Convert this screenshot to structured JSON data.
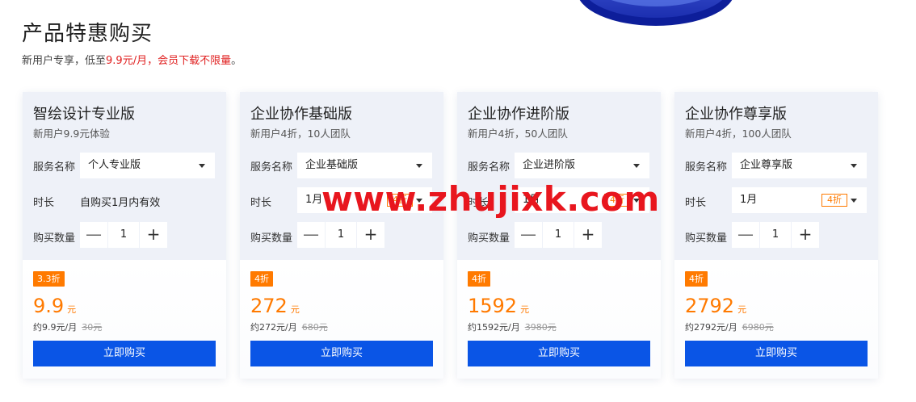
{
  "page": {
    "title": "产品特惠购买",
    "subtitle_prefix": "新用户专享，低至",
    "subtitle_highlight": "9.9元/月，会员下载不限量",
    "subtitle_suffix": "。"
  },
  "labels": {
    "service": "服务名称",
    "duration": "时长",
    "quantity": "购买数量"
  },
  "stepper_symbols": {
    "minus": "—",
    "plus": "+"
  },
  "cards": [
    {
      "title": "智绘设计专业版",
      "desc": "新用户9.9元体验",
      "service_value": "个人专业版",
      "duration_text": "自购买1月内有效",
      "quantity": "1",
      "badge": "3.3折",
      "price": "9.9",
      "price_unit": "元",
      "monthly": "约9.9元/月",
      "original": "30元",
      "buy_label": "立即购买"
    },
    {
      "title": "企业协作基础版",
      "desc": "新用户4折，10人团队",
      "service_value": "企业基础版",
      "duration_value": "1月",
      "duration_tag": "4折",
      "quantity": "1",
      "badge": "4折",
      "price": "272",
      "price_unit": "元",
      "monthly": "约272元/月",
      "original": "680元",
      "buy_label": "立即购买"
    },
    {
      "title": "企业协作进阶版",
      "desc": "新用户4折，50人团队",
      "service_value": "企业进阶版",
      "duration_value": "1月",
      "duration_tag": "4折",
      "quantity": "1",
      "badge": "4折",
      "price": "1592",
      "price_unit": "元",
      "monthly": "约1592元/月",
      "original": "3980元",
      "buy_label": "立即购买"
    },
    {
      "title": "企业协作尊享版",
      "desc": "新用户4折，100人团队",
      "service_value": "企业尊享版",
      "duration_value": "1月",
      "duration_tag": "4折",
      "quantity": "1",
      "badge": "4折",
      "price": "2792",
      "price_unit": "元",
      "monthly": "约2792元/月",
      "original": "6980元",
      "buy_label": "立即购买"
    }
  ],
  "watermark": "www.zhujixk.com",
  "colors": {
    "accent_orange": "#ff7a00",
    "button_blue": "#0a55e6",
    "highlight_red": "#e02020",
    "watermark_red": "#e8161e",
    "card_top_bg": "#eef1f8"
  }
}
